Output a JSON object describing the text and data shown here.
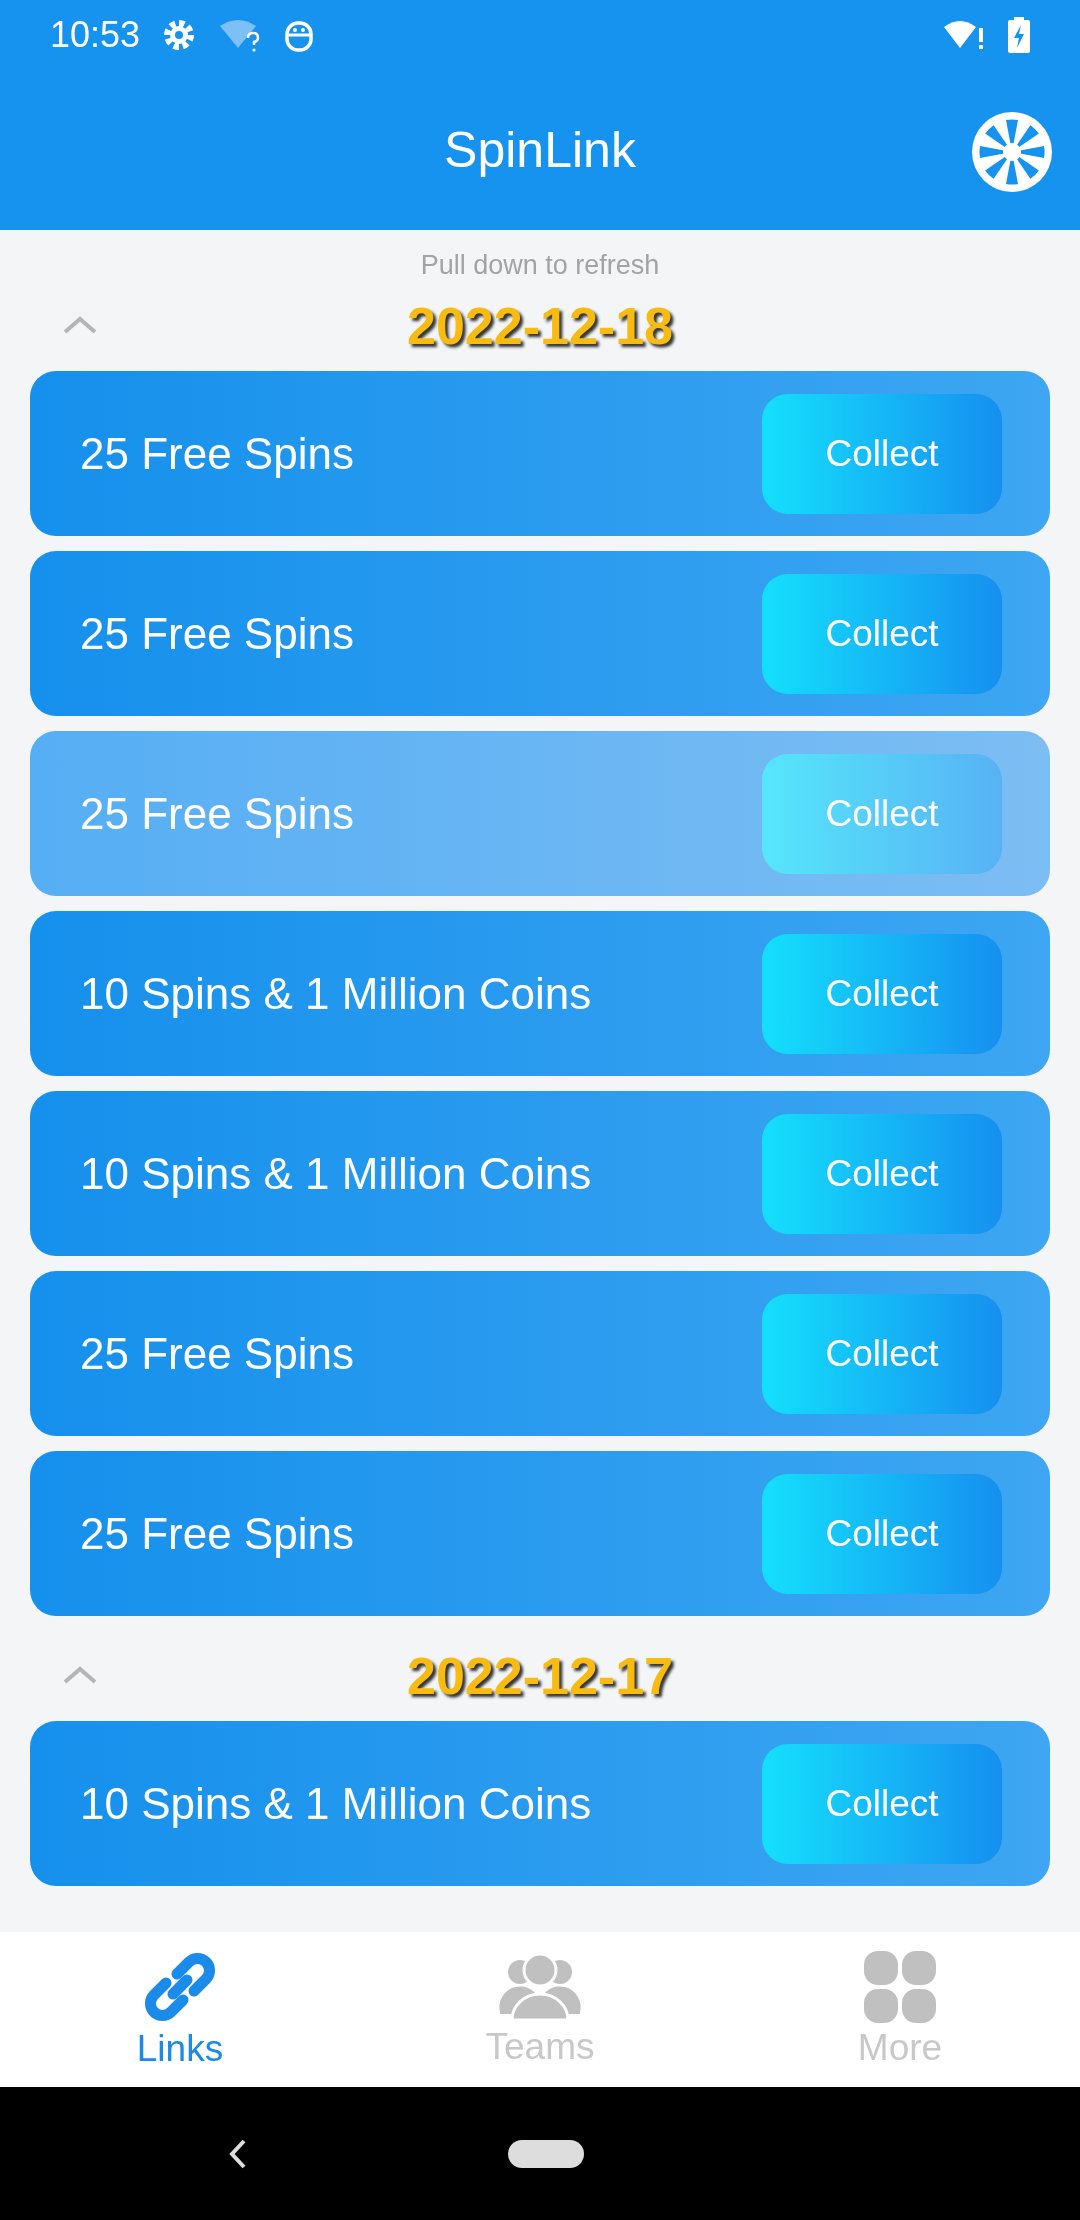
{
  "status_bar": {
    "time": "10:53"
  },
  "app_bar": {
    "title": "SpinLink"
  },
  "refresh_hint": "Pull down to refresh",
  "groups": [
    {
      "date": "2022-12-18",
      "expanded": true,
      "links": [
        {
          "label": "25 Free Spins",
          "button": "Collect",
          "dimmed": false
        },
        {
          "label": "25 Free Spins",
          "button": "Collect",
          "dimmed": false
        },
        {
          "label": "25 Free Spins",
          "button": "Collect",
          "dimmed": true
        },
        {
          "label": "10 Spins & 1 Million Coins",
          "button": "Collect",
          "dimmed": false
        },
        {
          "label": "10 Spins & 1 Million Coins",
          "button": "Collect",
          "dimmed": false
        },
        {
          "label": "25 Free Spins",
          "button": "Collect",
          "dimmed": false
        },
        {
          "label": "25 Free Spins",
          "button": "Collect",
          "dimmed": false
        }
      ]
    },
    {
      "date": "2022-12-17",
      "expanded": true,
      "links": [
        {
          "label": "10 Spins & 1 Million Coins",
          "button": "Collect",
          "dimmed": false
        }
      ]
    }
  ],
  "tabs": [
    {
      "label": "Links",
      "kind": "links",
      "selected": true
    },
    {
      "label": "Teams",
      "kind": "teams",
      "selected": false
    },
    {
      "label": "More",
      "kind": "more",
      "selected": false
    }
  ]
}
